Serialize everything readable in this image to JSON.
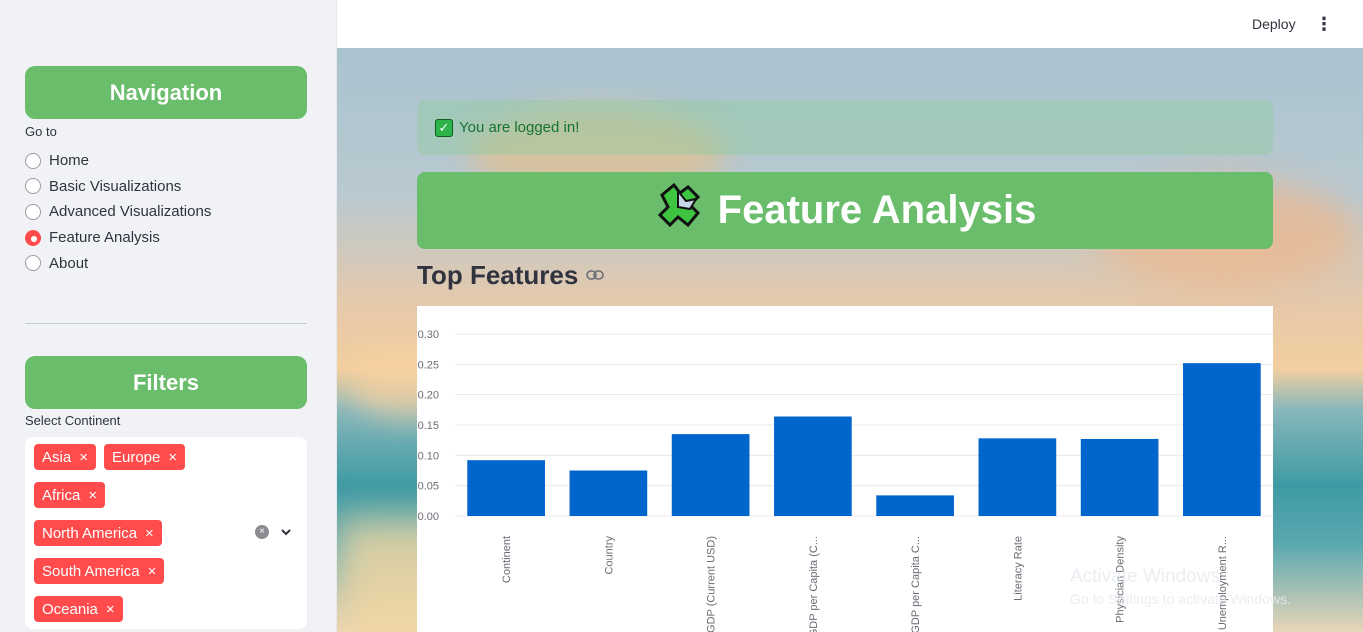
{
  "sidebar": {
    "nav_title": "Navigation",
    "goto_label": "Go to",
    "options": [
      {
        "label": "Home",
        "selected": false
      },
      {
        "label": "Basic Visualizations",
        "selected": false
      },
      {
        "label": "Advanced Visualizations",
        "selected": false
      },
      {
        "label": "Feature Analysis",
        "selected": true
      },
      {
        "label": "About",
        "selected": false
      }
    ],
    "filters_title": "Filters",
    "select_label": "Select Continent",
    "chips": [
      "Asia",
      "Europe",
      "Africa",
      "North America",
      "South America",
      "Oceania"
    ],
    "chip_close": "×",
    "clear_icon": "×",
    "dropdown_icon": "⌄"
  },
  "topbar": {
    "deploy_label": "Deploy",
    "menu_icon": "⋮"
  },
  "main": {
    "success_message": "You are logged in!",
    "check_icon": "✓",
    "page_title": "Feature Analysis",
    "section_title": "Top Features",
    "link_icon": "⛓"
  },
  "watermark": {
    "line1": "Activate Windows",
    "line2": "Go to Settings to activate Windows."
  },
  "colors": {
    "accent_green": "#6abd6b",
    "chip_red": "#ff4b4b",
    "bar_blue": "#0066cc"
  },
  "chart_data": {
    "type": "bar",
    "categories": [
      "Continent",
      "Country",
      "GDP (Current USD)",
      "GDP per Capita (C...",
      "GDP per Capita C...",
      "Literacy Rate",
      "Physician Density",
      "Unemployment R..."
    ],
    "values": [
      0.092,
      0.075,
      0.135,
      0.164,
      0.034,
      0.128,
      0.127,
      0.252
    ],
    "ylim": [
      0,
      0.3
    ],
    "yticks": [
      "0.00",
      "0.05",
      "0.10",
      "0.15",
      "0.20",
      "0.25",
      "0.30"
    ],
    "grid": true
  }
}
